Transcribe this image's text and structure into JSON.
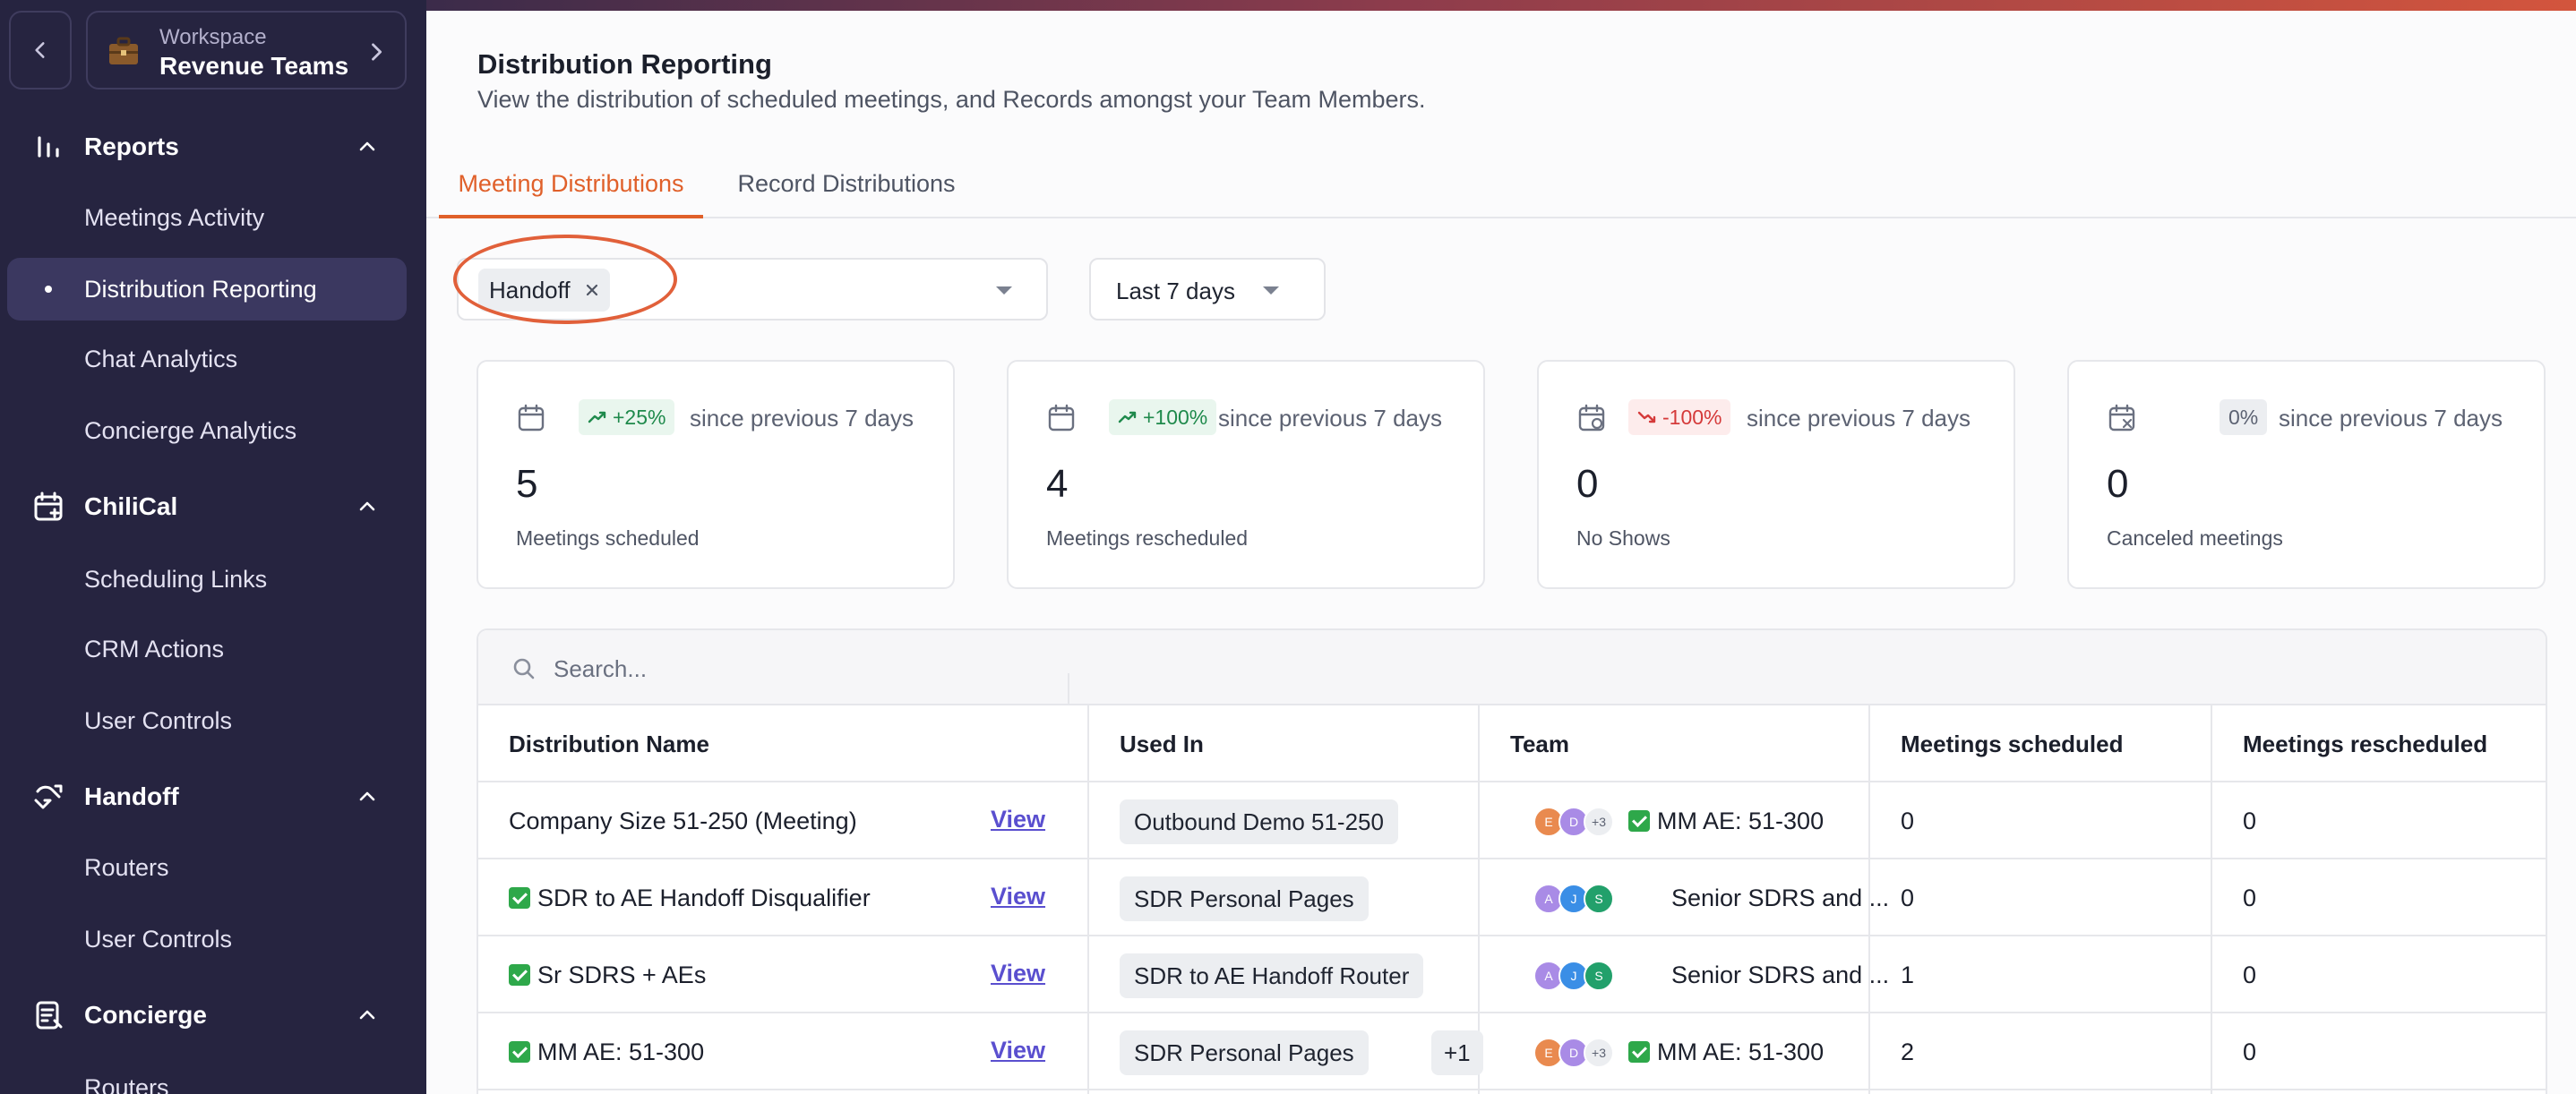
{
  "workspace": {
    "label": "Workspace",
    "name": "Revenue Teams"
  },
  "sidebar": {
    "sections": [
      {
        "label": "Reports",
        "icon": "bar-chart-icon",
        "items": [
          "Meetings Activity",
          "Distribution Reporting",
          "Chat Analytics",
          "Concierge Analytics"
        ]
      },
      {
        "label": "ChiliCal",
        "icon": "calendar-icon",
        "items": [
          "Scheduling Links",
          "CRM Actions",
          "User Controls"
        ]
      },
      {
        "label": "Handoff",
        "icon": "handoff-icon",
        "items": [
          "Routers",
          "User Controls"
        ]
      },
      {
        "label": "Concierge",
        "icon": "form-icon",
        "items": [
          "Routers"
        ]
      }
    ],
    "active_item": "Distribution Reporting"
  },
  "page": {
    "title": "Distribution Reporting",
    "subtitle": "View the distribution of scheduled meetings, and Records amongst your Team Members."
  },
  "tabs": [
    "Meeting Distributions",
    "Record Distributions"
  ],
  "filters": {
    "chip": "Handoff",
    "date_range": "Last 7 days"
  },
  "colors": {
    "accent": "#e0602a",
    "sidebar": "#262440",
    "link": "#5a4fcf",
    "up": "#1f8a4c",
    "down": "#d53a3a"
  },
  "stats": [
    {
      "badge": "+25%",
      "trend": "up",
      "since": "since previous 7 days",
      "value": "5",
      "label": "Meetings scheduled"
    },
    {
      "badge": "+100%",
      "trend": "up",
      "since": "since previous 7 days",
      "value": "4",
      "label": "Meetings rescheduled"
    },
    {
      "badge": "-100%",
      "trend": "down",
      "since": "since previous 7 days",
      "value": "0",
      "label": "No Shows"
    },
    {
      "badge": "0%",
      "trend": "flat",
      "since": "since previous 7 days",
      "value": "0",
      "label": "Canceled meetings"
    }
  ],
  "table": {
    "search_placeholder": "Search...",
    "columns": [
      "Distribution Name",
      "Used In",
      "Team",
      "Meetings scheduled",
      "Meetings rescheduled"
    ],
    "view_label": "View",
    "rows": [
      {
        "name": "Company Size 51-250 (Meeting)",
        "checked": false,
        "used_in": "Outbound Demo 51-250",
        "used_extra": "",
        "avatars": [
          "E",
          "D"
        ],
        "more": "+3",
        "team_checked": true,
        "team": "MM AE: 51-300",
        "scheduled": "0",
        "rescheduled": "0"
      },
      {
        "name": "SDR to AE Handoff Disqualifier",
        "checked": true,
        "used_in": "SDR Personal Pages",
        "used_extra": "",
        "avatars": [
          "A",
          "J",
          "S"
        ],
        "more": "",
        "team_checked": false,
        "team": "Senior SDRS and ...",
        "scheduled": "0",
        "rescheduled": "0"
      },
      {
        "name": "Sr SDRS + AEs",
        "checked": true,
        "used_in": "SDR to AE Handoff Router",
        "used_extra": "",
        "avatars": [
          "A",
          "J",
          "S"
        ],
        "more": "",
        "team_checked": false,
        "team": "Senior SDRS and ...",
        "scheduled": "1",
        "rescheduled": "0"
      },
      {
        "name": "MM AE: 51-300",
        "checked": true,
        "used_in": "SDR Personal Pages",
        "used_extra": "+1",
        "avatars": [
          "E",
          "D"
        ],
        "more": "+3",
        "team_checked": true,
        "team": "MM AE: 51-300",
        "scheduled": "2",
        "rescheduled": "0"
      }
    ]
  }
}
